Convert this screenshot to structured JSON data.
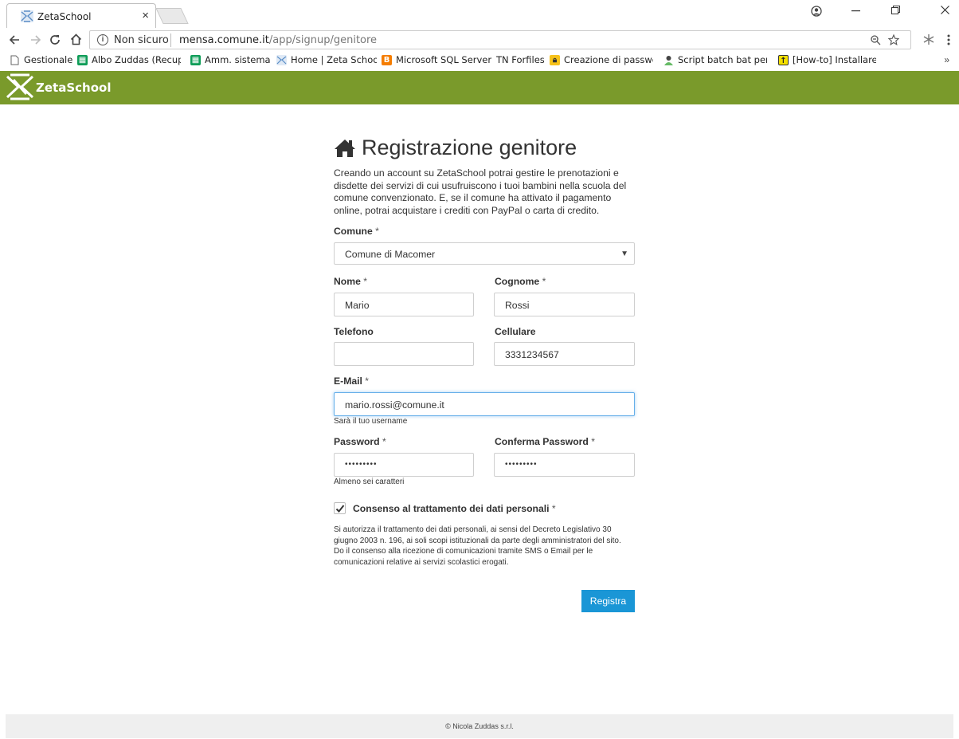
{
  "browser": {
    "tab_title": "ZetaSchool",
    "tab_close": "×",
    "security_label": "Non sicuro",
    "url_host": "mensa.comune.it",
    "url_path": "/app/signup/genitore",
    "bookmarks": [
      {
        "label": "Gestionale",
        "icon": "page-icon"
      },
      {
        "label": "Albo Zuddas (Recupe",
        "icon": "sheets-icon"
      },
      {
        "label": "Amm. sistema",
        "icon": "sheets-icon"
      },
      {
        "label": "Home | Zeta School",
        "icon": "zetaschool-icon"
      },
      {
        "label": "Microsoft SQL Server",
        "icon": "blogger-icon"
      },
      {
        "label": "TN  Forfiles",
        "icon": "none"
      },
      {
        "label": "Creazione di passwor",
        "icon": "lock-icon"
      },
      {
        "label": "Script batch bat per e",
        "icon": "person-icon"
      },
      {
        "label": "[How-to] Installare ce",
        "icon": "arrow-icon"
      }
    ],
    "more_bookmarks": "»"
  },
  "app": {
    "brand": "ZetaSchool",
    "brand_color": "#7a9a2b"
  },
  "form": {
    "title": "Registrazione genitore",
    "intro": "Creando un account su ZetaSchool potrai gestire le prenotazioni e disdette dei servizi di cui usufruiscono i tuoi bambini nella scuola del comune convenzionato. E, se il comune ha attivato il pagamento online, potrai acquistare i crediti con PayPal o carta di credito.",
    "comune_label": "Comune",
    "comune_value": "Comune di Macomer",
    "nome_label": "Nome",
    "nome_value": "Mario",
    "cognome_label": "Cognome",
    "cognome_value": "Rossi",
    "telefono_label": "Telefono",
    "telefono_value": "",
    "cellulare_label": "Cellulare",
    "cellulare_value": "3331234567",
    "email_label": "E-Mail",
    "email_value": "mario.rossi@comune.it",
    "email_help": "Sarà il tuo username",
    "password_label": "Password",
    "password_value": "•••••••••",
    "confirm_label": "Conferma Password",
    "confirm_value": "•••••••••",
    "password_help": "Almeno sei caratteri",
    "required_mark": "*",
    "consent_label": "Consenso al trattamento dei dati personali",
    "consent_checked": true,
    "consent_text": "Si autorizza il trattamento dei dati personali, ai sensi del Decreto Legislativo 30 giugno 2003 n. 196, ai soli scopi istituzionali da parte degli amministratori del sito. Do il consenso alla ricezione di comunicazioni tramite SMS o Email per le comunicazioni relative ai servizi scolastici erogati.",
    "submit_label": "Registra",
    "submit_color": "#1a96d6"
  },
  "footer": {
    "text": "© Nicola Zuddas s.r.l."
  }
}
